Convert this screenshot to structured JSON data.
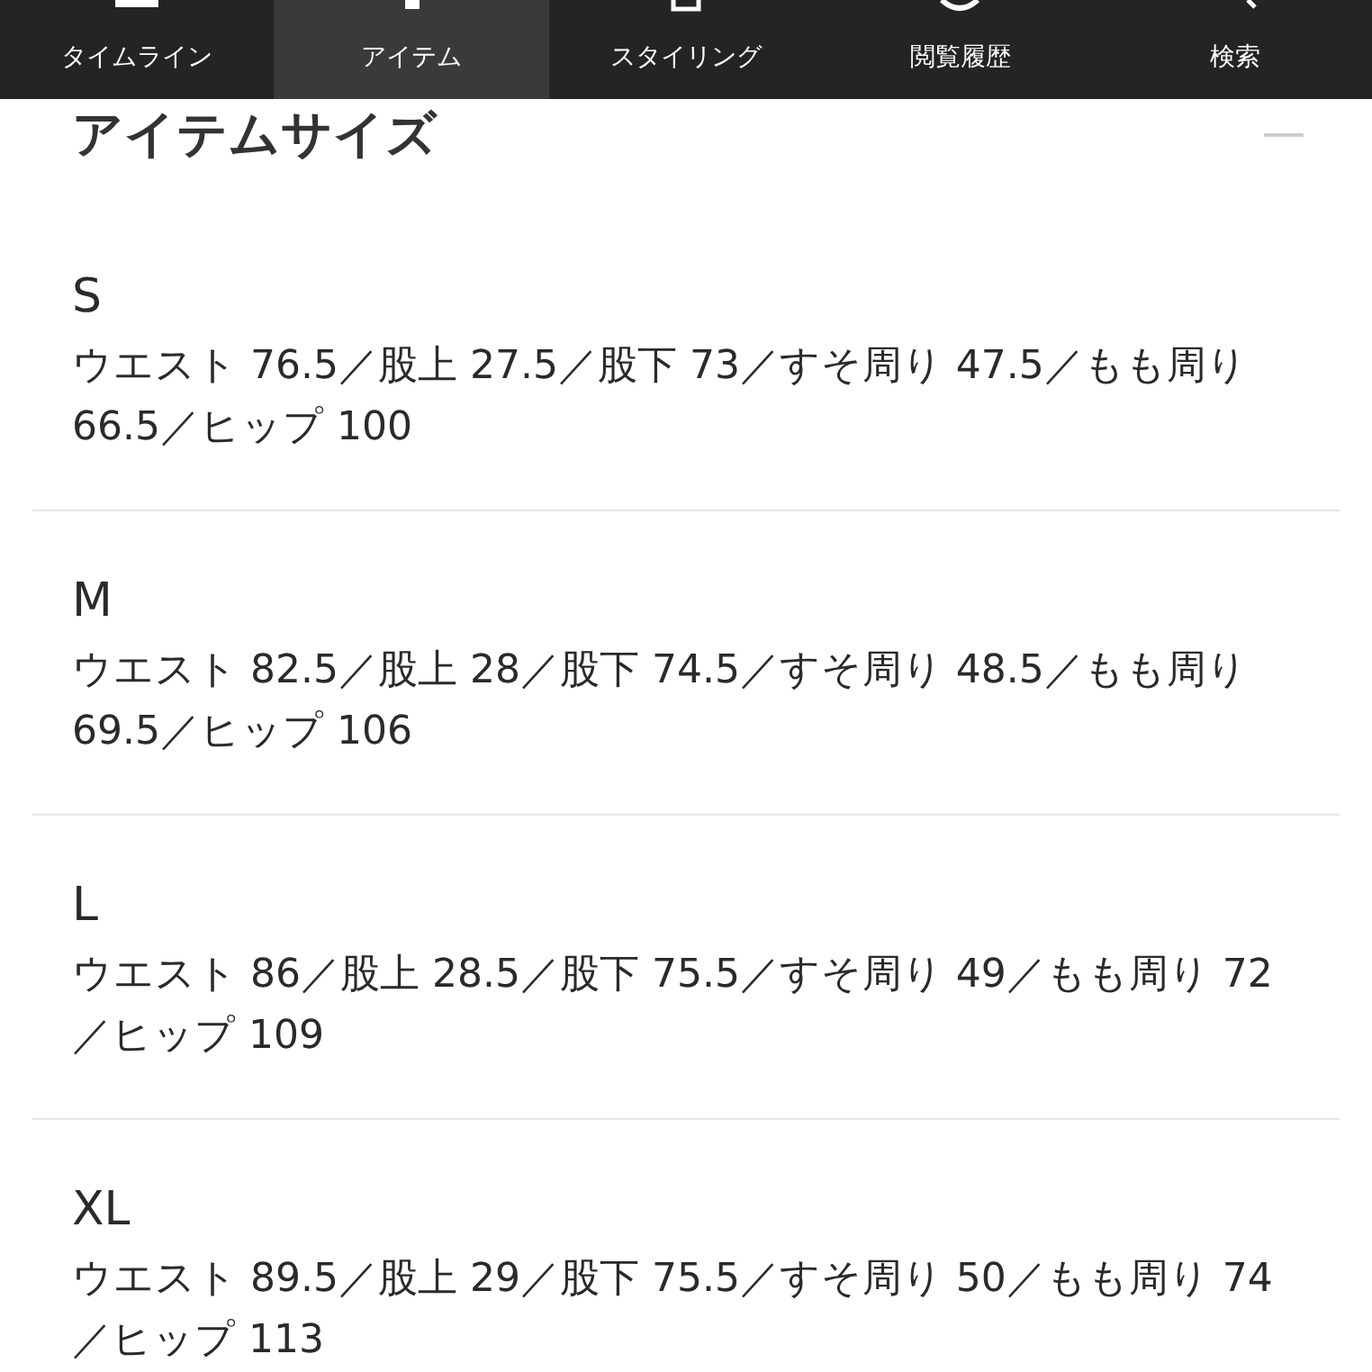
{
  "tabs": [
    {
      "label": "タイムライン",
      "selected": false
    },
    {
      "label": "アイテム",
      "selected": true
    },
    {
      "label": "スタイリング",
      "selected": false
    },
    {
      "label": "閲覧履歴",
      "selected": false
    },
    {
      "label": "検索",
      "selected": false
    }
  ],
  "section": {
    "title": "アイテムサイズ",
    "expanded": true,
    "sizes": [
      {
        "size": "S",
        "details": "ウエスト 76.5／股上 27.5／股下 73／すそ周り 47.5／もも周り 66.5／ヒップ 100"
      },
      {
        "size": "M",
        "details": "ウエスト 82.5／股上 28／股下 74.5／すそ周り 48.5／もも周り 69.5／ヒップ 106"
      },
      {
        "size": "L",
        "details": "ウエスト 86／股上 28.5／股下 75.5／すそ周り 49／もも周り 72 ／ヒップ 109"
      },
      {
        "size": "XL",
        "details": "ウエスト 89.5／股上 29／股下 75.5／すそ周り 50／もも周り 74 ／ヒップ 113"
      }
    ]
  }
}
